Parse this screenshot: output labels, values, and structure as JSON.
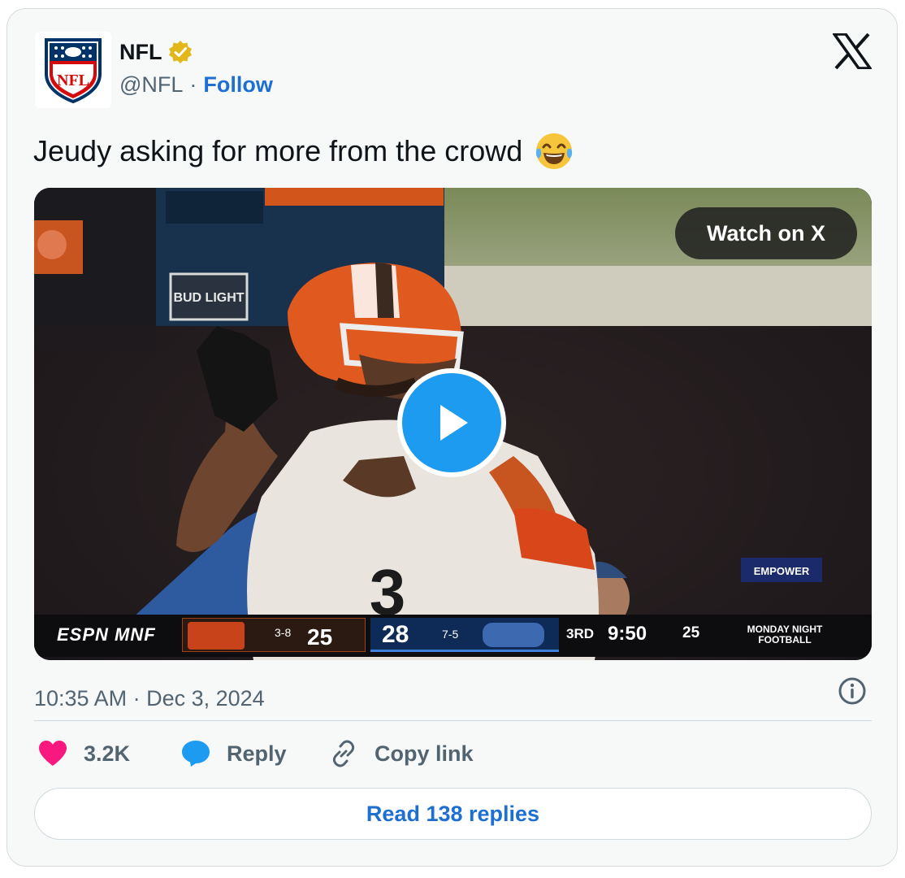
{
  "account": {
    "name": "NFL",
    "handle": "@NFL",
    "separator": "·",
    "follow_label": "Follow",
    "verified": true,
    "logo_text": "NFL"
  },
  "tweet": {
    "text": "Jeudy asking for more from the crowd",
    "emoji": "😂"
  },
  "media": {
    "watch_label": "Watch on X",
    "scorebug": {
      "network": "ESPN MNF",
      "away_record": "3-8",
      "away_score": "25",
      "home_score": "28",
      "home_record": "7-5",
      "quarter": "3RD",
      "clock": "9:50",
      "play_clock": "25",
      "show": "MONDAY NIGHT FOOTBALL"
    },
    "stadium_sign": "BUD LIGHT",
    "banner_text": "EMPOWER"
  },
  "timestamp": "10:35 AM · Dec 3, 2024",
  "actions": {
    "likes": "3.2K",
    "reply_label": "Reply",
    "copy_label": "Copy link"
  },
  "read_replies_label": "Read 138 replies",
  "colors": {
    "accent": "#1d6fd1",
    "like": "#f91880",
    "reply": "#1d9bf0",
    "card_bg": "#f7f9f9"
  }
}
